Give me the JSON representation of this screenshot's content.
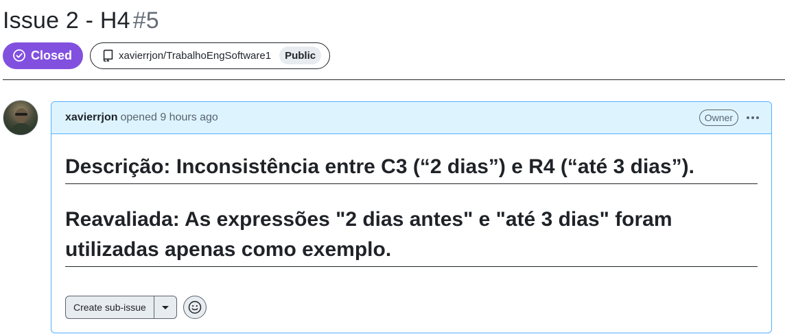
{
  "issue": {
    "title": "Issue 2 - H4",
    "number": "#5",
    "state": "Closed",
    "state_color": "#8250df",
    "state_icon": "check-circle-icon",
    "repository": "xavierrjon/TrabalhoEngSoftware1",
    "repository_icon": "repo-icon",
    "visibility": "Public"
  },
  "comment": {
    "author": "xavierrjon",
    "opened_text": "opened 9 hours ago",
    "role": "Owner",
    "menu_icon": "kebab-horizontal-icon",
    "border_color": "#54aeff",
    "header_background": "#ddf4ff",
    "body": {
      "heading_1": "Descrição: Inconsistência entre C3 (“2 dias”) e R4 (“até 3 dias”).",
      "heading_2": "Reavaliada: As expressões \"2 dias antes\" e \"até 3 dias\" foram utilizadas apenas como exemplo."
    },
    "actions": {
      "create_sub_issue": "Create sub-issue",
      "dropdown_icon": "triangle-down-icon",
      "reaction_icon": "smiley-icon"
    }
  }
}
